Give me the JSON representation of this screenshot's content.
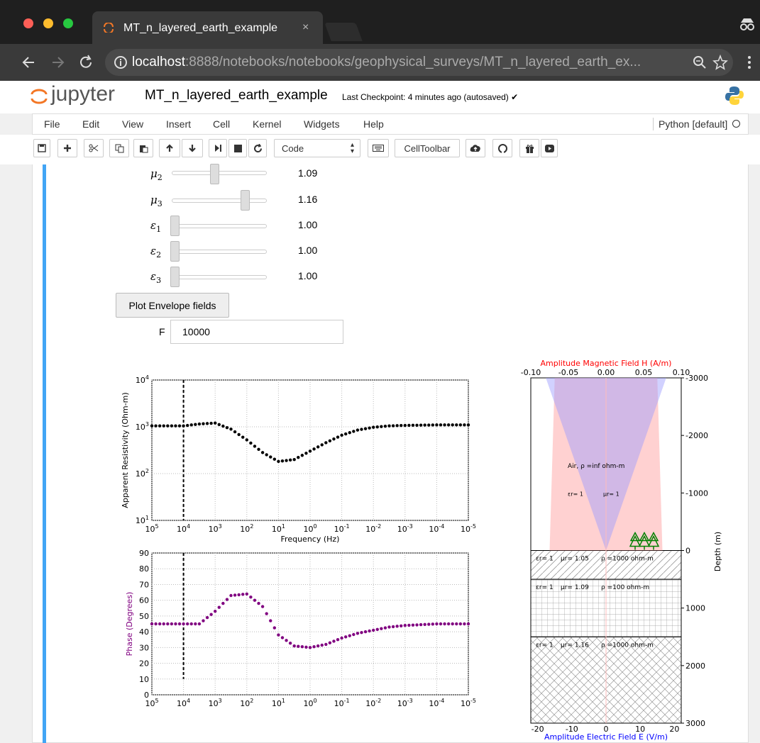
{
  "browser": {
    "tab_title": "MT_n_layered_earth_example",
    "tab_close": "×",
    "url_host": "localhost",
    "url_path": ":8888/notebooks/notebooks/geophysical_surveys/MT_n_layered_earth_ex...",
    "icons": [
      "jupyter-spinner-icon",
      "back-icon",
      "forward-icon",
      "reload-icon",
      "info-icon",
      "zoom-icon",
      "star-icon",
      "more-icon",
      "incognito-icon"
    ],
    "traffic_colors": [
      "#fd5f57",
      "#fdbc2e",
      "#27c840"
    ]
  },
  "header": {
    "logo_text": "jupyter",
    "notebook_name": "MT_n_layered_earth_example",
    "checkpoint": "Last Checkpoint: 4 minutes ago (autosaved)"
  },
  "menu": {
    "items": [
      "File",
      "Edit",
      "View",
      "Insert",
      "Cell",
      "Kernel",
      "Widgets",
      "Help"
    ],
    "kernel": "Python [default]"
  },
  "toolbar": {
    "cell_type": "Code",
    "celltoolbar": "CellToolbar",
    "icons": [
      "save-icon",
      "add-icon",
      "cut-icon",
      "copy-icon",
      "paste-icon",
      "move-up-icon",
      "move-down-icon",
      "run-icon",
      "stop-icon",
      "restart-icon",
      "keyboard-icon",
      "upload-icon",
      "github-icon",
      "gift-icon",
      "youtube-icon"
    ]
  },
  "widgets": {
    "sliders": [
      {
        "label_base": "μ",
        "label_sub": "2",
        "value": "1.09",
        "level": 0.46
      },
      {
        "label_base": "μ",
        "label_sub": "3",
        "value": "1.16",
        "level": 0.8
      },
      {
        "label_base": "ε",
        "label_sub": "1",
        "value": "1.00",
        "level": 0.0
      },
      {
        "label_base": "ε",
        "label_sub": "2",
        "value": "1.00",
        "level": 0.0
      },
      {
        "label_base": "ε",
        "label_sub": "3",
        "value": "1.00",
        "level": 0.0
      }
    ],
    "plot_button": "Plot Envelope fields",
    "f_label": "F",
    "f_value": "10000"
  },
  "chart_data": [
    {
      "type": "scatter",
      "xlabel": "Frequency (Hz)",
      "ylabel": "Apparent Resistivity (Ohm-m)",
      "y_scale": "log",
      "x_scale": "log-reversed",
      "xlim": [
        100000,
        1e-05
      ],
      "ylim": [
        10,
        10000
      ],
      "x_tick_labels": [
        "10^5",
        "10^4",
        "10^3",
        "10^2",
        "10^1",
        "10^0",
        "10^-1",
        "10^-2",
        "10^-3",
        "10^-4",
        "10^-5"
      ],
      "y_tick_labels": [
        "10^1",
        "10^2",
        "10^3",
        "10^4"
      ],
      "grid": true,
      "vline_x": 10000,
      "marker_color": "#000000",
      "series": [
        {
          "x_log10": [
            5,
            4,
            3.5,
            3,
            2.5,
            2,
            1.5,
            1,
            0.5,
            0,
            -0.5,
            -1,
            -1.5,
            -2,
            -2.5,
            -3,
            -4,
            -5
          ],
          "y_log10": [
            3.02,
            3.02,
            3.06,
            3.08,
            2.95,
            2.72,
            2.45,
            2.26,
            2.3,
            2.48,
            2.66,
            2.82,
            2.93,
            2.99,
            3.02,
            3.03,
            3.04,
            3.04
          ]
        }
      ]
    },
    {
      "type": "scatter",
      "xlabel": "",
      "ylabel": "Phase (Degrees)",
      "x_scale": "log-reversed",
      "xlim": [
        100000,
        1e-05
      ],
      "ylim": [
        0,
        90
      ],
      "x_tick_labels": [
        "10^5",
        "10^4",
        "10^3",
        "10^2",
        "10^1",
        "10^0",
        "10^-1",
        "10^-2",
        "10^-3",
        "10^-4",
        "10^-5"
      ],
      "y_ticks": [
        0,
        10,
        20,
        30,
        40,
        50,
        60,
        70,
        80,
        90
      ],
      "grid": true,
      "vline_x": 10000,
      "marker_color": "#800080",
      "series": [
        {
          "x_log10": [
            5,
            4.5,
            4,
            3.5,
            3,
            2.5,
            2,
            1.5,
            1,
            0.5,
            0,
            -0.5,
            -1,
            -1.5,
            -2,
            -2.5,
            -3,
            -4,
            -5
          ],
          "y": [
            45,
            45,
            45,
            45,
            53,
            63,
            64,
            56,
            38,
            31,
            30,
            32,
            36,
            39,
            41,
            43,
            44,
            45,
            45
          ]
        }
      ]
    },
    {
      "type": "area",
      "top_label": "Amplitude Magnetic Field H (A/m)",
      "bottom_label": "Amplitude Electric Field E (V/m)",
      "right_label": "Depth (m)",
      "top_tick_labels": [
        "-0.10",
        "-0.05",
        "0.00",
        "0.05",
        "0.10"
      ],
      "bottom_tick_labels": [
        "-20",
        "-10",
        "0",
        "10",
        "20"
      ],
      "depth_tick_labels": [
        "-3000",
        "-2000",
        "-1000",
        "0",
        "1000",
        "2000",
        "3000"
      ],
      "air_label": "Air, ρ =inf ohm-m",
      "air_params": [
        "εr = 1",
        "μr = 1"
      ],
      "layers": [
        {
          "eps": "εr = 1",
          "mu": "μr = 1.05",
          "rho": "ρ =1000 ohm-m",
          "top": 0,
          "bottom": 500,
          "hatch": "diagonal"
        },
        {
          "eps": "εr = 1",
          "mu": "μr = 1.09",
          "rho": "ρ =100 ohm-m",
          "top": 500,
          "bottom": 1500,
          "hatch": "grid"
        },
        {
          "eps": "εr = 1",
          "mu": "μr = 1.16",
          "rho": "ρ =1000 ohm-m",
          "top": 1500,
          "bottom": 3000,
          "hatch": "cross"
        }
      ],
      "colors": {
        "h_field": "#ff0000",
        "e_field": "#0000ff",
        "tree": "#008000"
      }
    }
  ]
}
